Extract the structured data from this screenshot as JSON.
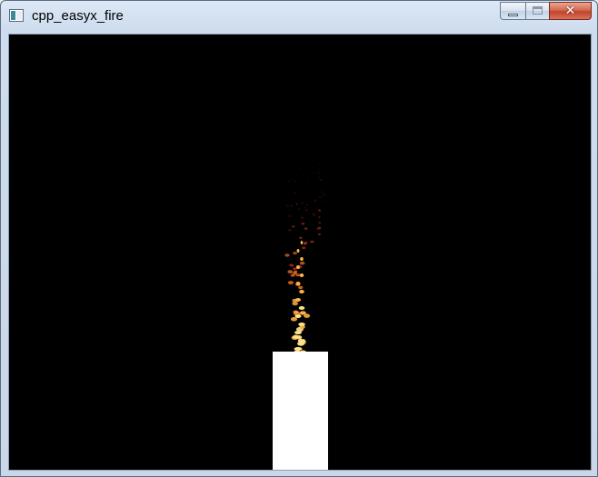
{
  "window": {
    "title": "cpp_easyx_fire",
    "app_icon": "window-app-icon",
    "buttons": {
      "minimize_icon": "minimize-icon",
      "maximize_icon": "maximize-icon",
      "close_icon": "close-icon",
      "close_glyph": "✕"
    }
  },
  "canvas": {
    "background": "#000000",
    "candle_color": "#ffffff",
    "flame_colors": [
      "#ffe08a",
      "#ffb347",
      "#ff7a2a",
      "#c0391e",
      "#5a140a"
    ]
  }
}
